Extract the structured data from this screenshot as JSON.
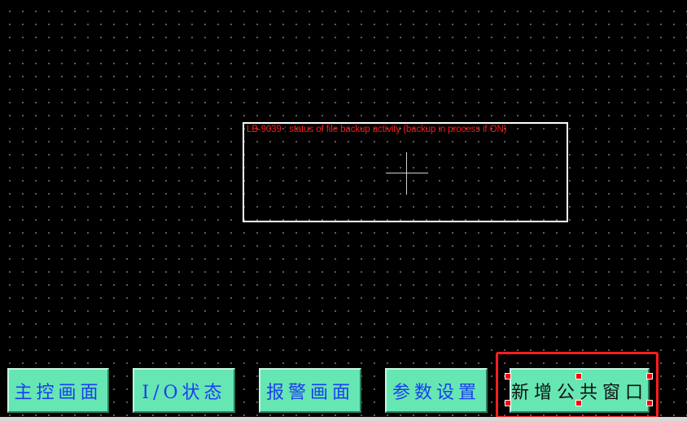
{
  "editor": {
    "bit_lamp": {
      "label": "LB-9039 : status of file backup activity (backup in process if ON)"
    },
    "buttons": [
      {
        "label": "主控画面",
        "selected": false
      },
      {
        "label": "I/O状态",
        "selected": false
      },
      {
        "label": "报警画面",
        "selected": false
      },
      {
        "label": "参数设置",
        "selected": false
      },
      {
        "label": "新增公共窗口",
        "selected": true
      }
    ],
    "colors": {
      "background": "#000000",
      "grid_dot": "#6a6a6a",
      "button_fill": "#66e6b3",
      "button_text": "#1a3df0",
      "selected_button_text": "#101010",
      "selection": "#ff1e1e",
      "lamp_label": "#ff1a1a",
      "lamp_border": "#ffffff"
    },
    "icons": {
      "lamp_center": "crosshair-icon",
      "selection_handle": "resize-handle-icon"
    }
  }
}
